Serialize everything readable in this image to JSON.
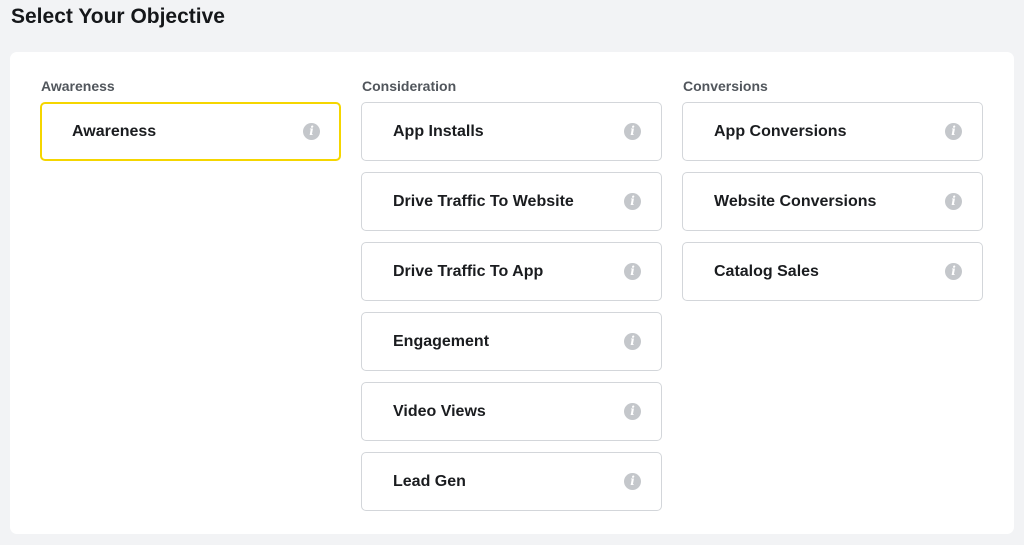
{
  "page": {
    "title": "Select Your Objective"
  },
  "info_glyph": "i",
  "icons": {
    "info": "info-icon"
  },
  "colors": {
    "selected_border": "#f5d600",
    "card_border": "#d3d6da",
    "info_icon": "#c4c7cb",
    "background": "#f2f3f5"
  },
  "columns": [
    {
      "heading": "Awareness",
      "options": [
        {
          "label": "Awareness",
          "selected": true
        }
      ]
    },
    {
      "heading": "Consideration",
      "options": [
        {
          "label": "App Installs",
          "selected": false
        },
        {
          "label": "Drive Traffic To Website",
          "selected": false
        },
        {
          "label": "Drive Traffic To App",
          "selected": false
        },
        {
          "label": "Engagement",
          "selected": false
        },
        {
          "label": "Video Views",
          "selected": false
        },
        {
          "label": "Lead Gen",
          "selected": false
        }
      ]
    },
    {
      "heading": "Conversions",
      "options": [
        {
          "label": "App Conversions",
          "selected": false
        },
        {
          "label": "Website Conversions",
          "selected": false
        },
        {
          "label": "Catalog Sales",
          "selected": false
        }
      ]
    }
  ]
}
